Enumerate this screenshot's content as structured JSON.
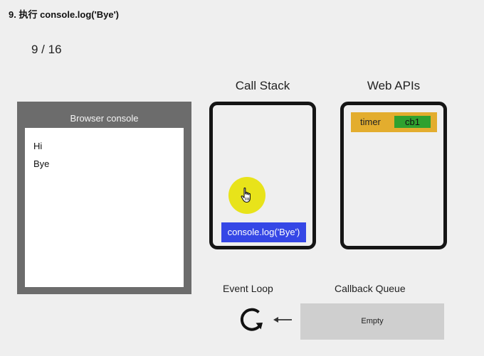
{
  "header": {
    "step_title": "9. 执行 console.log('Bye')",
    "counter": "9 / 16"
  },
  "browser_console": {
    "title": "Browser console",
    "lines": [
      "Hi",
      "Bye"
    ]
  },
  "call_stack": {
    "heading": "Call Stack",
    "frames": [
      "console.log('Bye')"
    ]
  },
  "web_apis": {
    "heading": "Web APIs",
    "timer_label": "timer",
    "timer_callback": "cb1"
  },
  "event_loop": {
    "label": "Event Loop"
  },
  "callback_queue": {
    "label": "Callback Queue",
    "empty_text": "Empty"
  },
  "colors": {
    "stack_frame": "#3547e6",
    "timer_row": "#e3ad2e",
    "timer_callback": "#2fa12f",
    "cursor_highlight": "#e8e31a",
    "console_frame": "#6c6c6c",
    "queue_background": "#cfcfcf"
  },
  "icons": {
    "cursor": "hand-pointer-icon",
    "loop": "refresh-loop-icon",
    "arrow": "arrow-left-icon"
  }
}
